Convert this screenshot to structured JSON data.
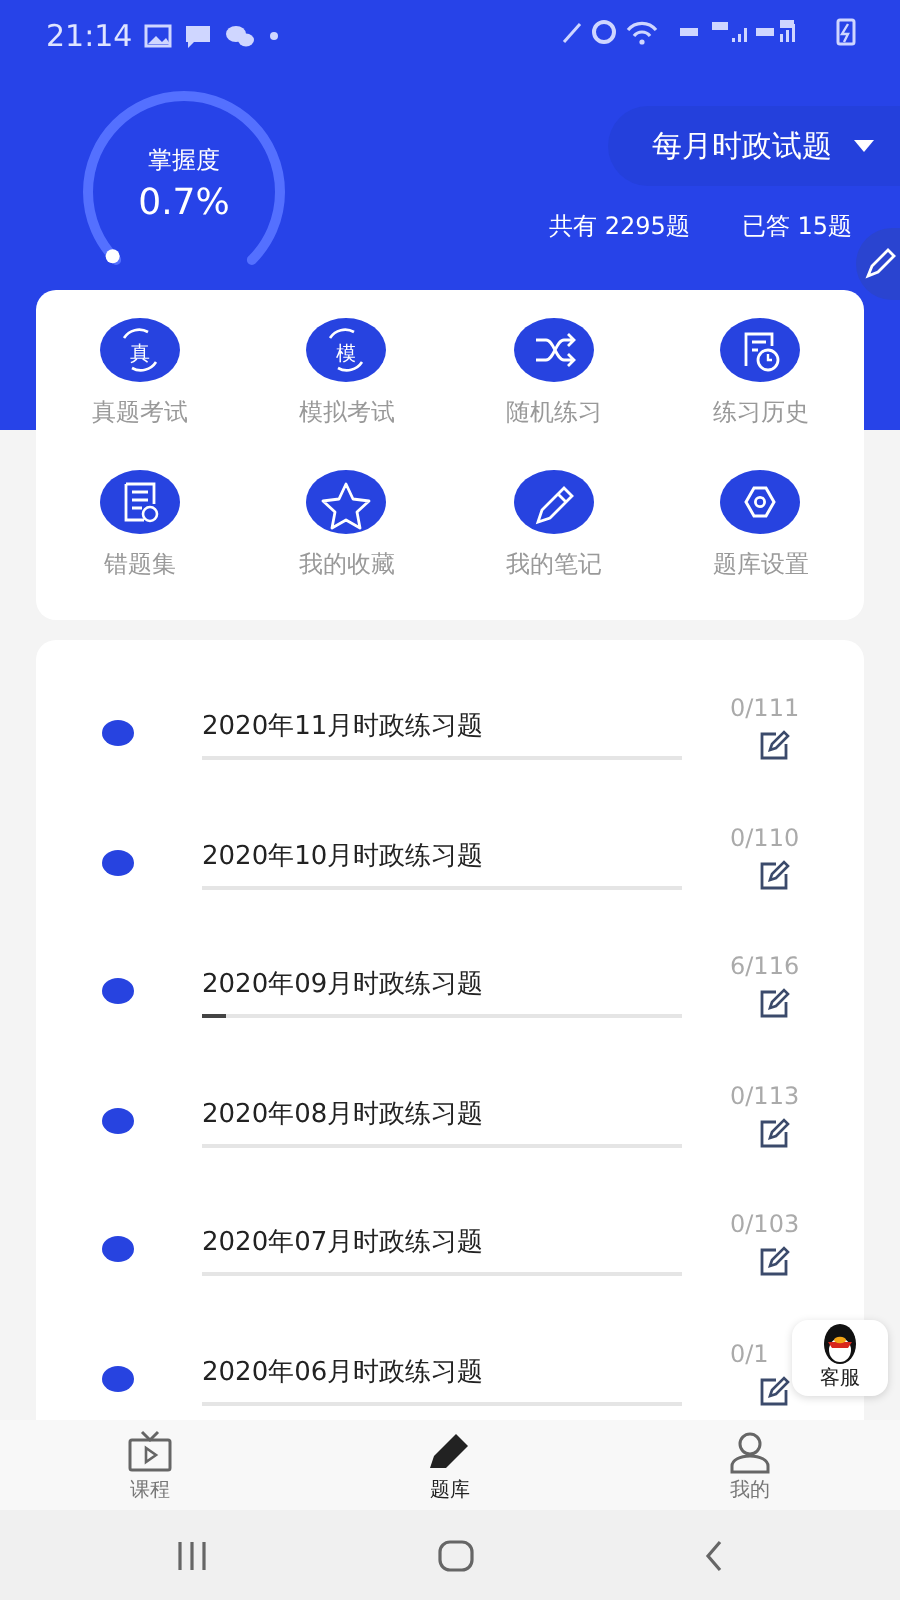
{
  "status_bar": {
    "time": "21:14"
  },
  "header": {
    "gauge": {
      "label": "掌握度",
      "value": "0.7%"
    },
    "bank_selector": {
      "label": "每月时政试题"
    },
    "total": "共有 2295题",
    "answered": "已答 15题"
  },
  "shortcuts": [
    {
      "label": "真题考试",
      "icon_text": "真"
    },
    {
      "label": "模拟考试",
      "icon_text": "模"
    },
    {
      "label": "随机练习"
    },
    {
      "label": "练习历史"
    },
    {
      "label": "错题集"
    },
    {
      "label": "我的收藏"
    },
    {
      "label": "我的笔记"
    },
    {
      "label": "题库设置"
    }
  ],
  "exercises": [
    {
      "title": "2020年11月时政练习题",
      "count": "0/111",
      "level": 0
    },
    {
      "title": "2020年10月时政练习题",
      "count": "0/110",
      "level": 0
    },
    {
      "title": "2020年09月时政练习题",
      "count": "6/116",
      "level": 0.05
    },
    {
      "title": "2020年08月时政练习题",
      "count": "0/113",
      "level": 0
    },
    {
      "title": "2020年07月时政练习题",
      "count": "0/103",
      "level": 0
    },
    {
      "title": "2020年06月时政练习题",
      "count": "0/1",
      "level": 0
    }
  ],
  "support_button": {
    "label": "客服"
  },
  "bottom_nav": [
    {
      "label": "课程",
      "selected": false
    },
    {
      "label": "题库",
      "selected": true
    },
    {
      "label": "我的",
      "selected": false
    }
  ]
}
